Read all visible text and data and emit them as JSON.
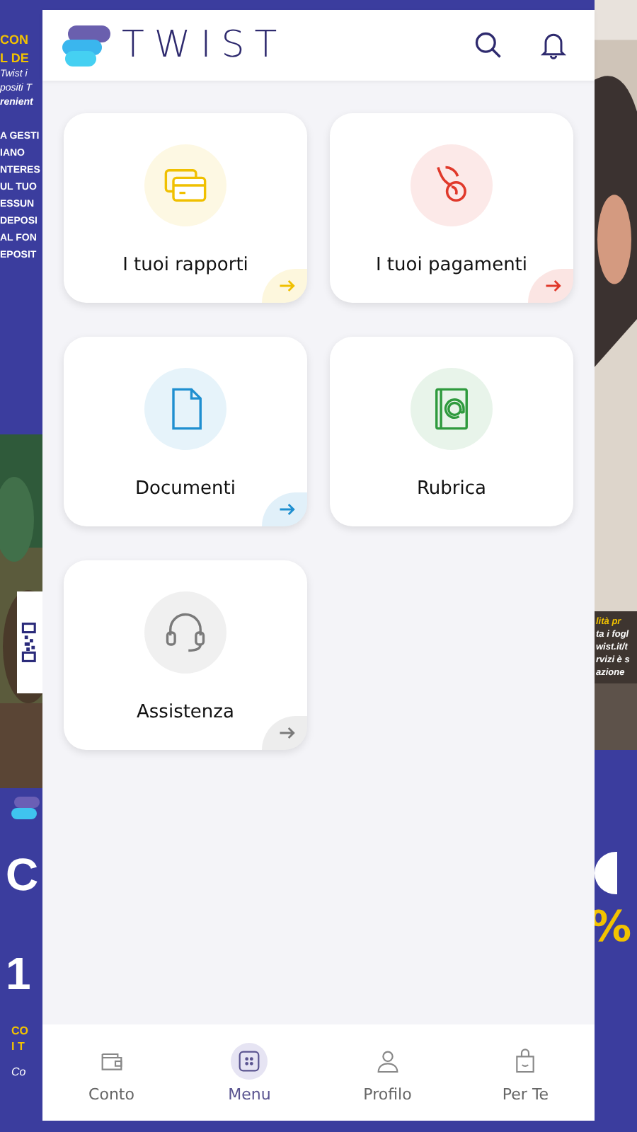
{
  "backdrop": {
    "left_texts": [
      {
        "text": "CON",
        "kind": "heading"
      },
      {
        "text": "L DE",
        "kind": "heading"
      },
      {
        "text": "Twist i",
        "kind": "italic"
      },
      {
        "text": "positi T",
        "kind": "italic"
      },
      {
        "text": "renient",
        "kind": "italic-bold"
      },
      {
        "text": "A GESTI",
        "kind": "caps"
      },
      {
        "text": "IANO",
        "kind": "caps"
      },
      {
        "text": "NTERES",
        "kind": "caps"
      },
      {
        "text": "UL TUO",
        "kind": "caps"
      },
      {
        "text": "ESSUN",
        "kind": "caps"
      },
      {
        "text": "DEPOSI",
        "kind": "caps"
      },
      {
        "text": "AL FON",
        "kind": "caps"
      },
      {
        "text": "EPOSIT",
        "kind": "caps"
      }
    ],
    "left_big": [
      "C",
      "1"
    ],
    "left_footer": [
      "CO",
      "I T"
    ],
    "left_last": "Co",
    "right_texts": [
      {
        "text": "lità pr",
        "kind": "highlight"
      },
      {
        "text": "ta i fogl",
        "kind": "italic"
      },
      {
        "text": "wist.it/t",
        "kind": "italic"
      },
      {
        "text": "rvizi è s",
        "kind": "italic"
      },
      {
        "text": "azione",
        "kind": "italic"
      }
    ],
    "right_big": "%"
  },
  "app": {
    "brand": "TWIST",
    "cards": [
      {
        "label": "I tuoi rapporti",
        "kind": "cards",
        "color": "#f0c000",
        "has_arrow": true
      },
      {
        "label": "I tuoi pagamenti",
        "kind": "payment",
        "color": "#e0392b",
        "has_arrow": true
      },
      {
        "label": "Documenti",
        "kind": "document",
        "color": "#1f8fd0",
        "has_arrow": true
      },
      {
        "label": "Rubrica",
        "kind": "contacts",
        "color": "#2f9a3e",
        "has_arrow": false
      },
      {
        "label": "Assistenza",
        "kind": "support",
        "color": "#7a7a7a",
        "has_arrow": true
      }
    ],
    "nav": [
      {
        "label": "Conto",
        "kind": "wallet",
        "selected": false
      },
      {
        "label": "Menu",
        "kind": "menu",
        "selected": true
      },
      {
        "label": "Profilo",
        "kind": "profile",
        "selected": false
      },
      {
        "label": "Per Te",
        "kind": "bag",
        "selected": false
      }
    ]
  }
}
